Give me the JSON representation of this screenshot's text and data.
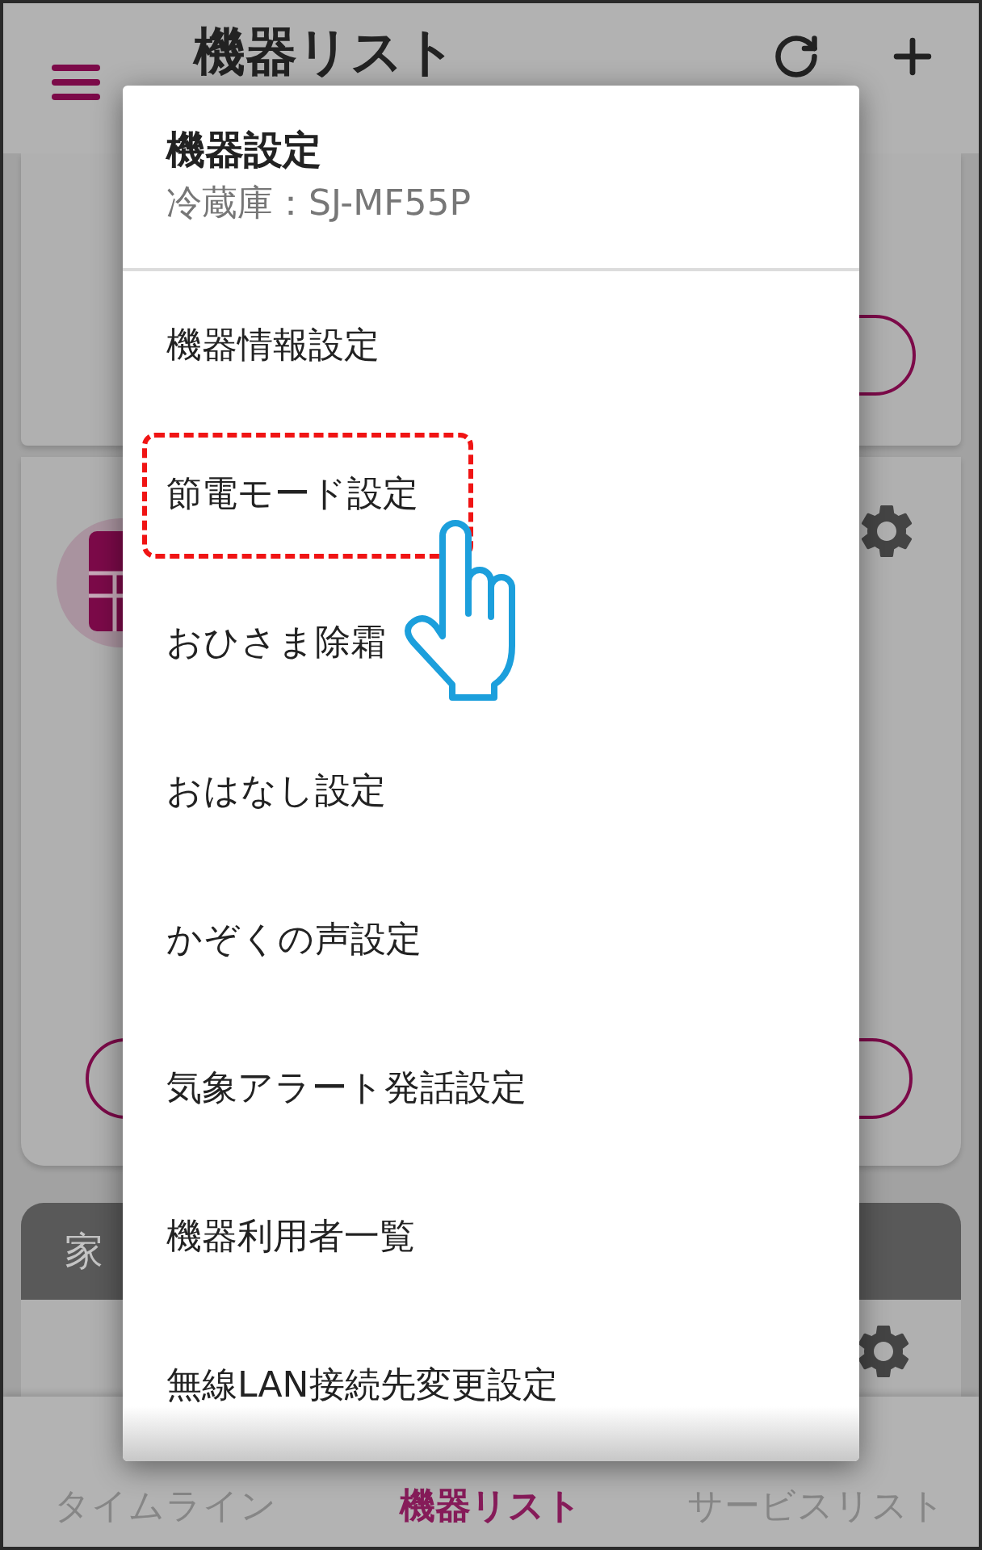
{
  "app_bar": {
    "title": "機器リスト"
  },
  "category_header": {
    "label": "家"
  },
  "dialog": {
    "title": "機器設定",
    "subtitle": "冷蔵庫：SJ-MF55P",
    "items": [
      {
        "label": "機器情報設定",
        "highlighted": false
      },
      {
        "label": "節電モード設定",
        "highlighted": true
      },
      {
        "label": "おひさま除霜",
        "highlighted": false
      },
      {
        "label": "おはなし設定",
        "highlighted": false
      },
      {
        "label": "かぞくの声設定",
        "highlighted": false
      },
      {
        "label": "気象アラート発話設定",
        "highlighted": false
      },
      {
        "label": "機器利用者一覧",
        "highlighted": false
      },
      {
        "label": "無線LAN接続先変更設定",
        "highlighted": false
      }
    ]
  },
  "bottom_nav": {
    "tabs": [
      {
        "label": "タイムライン",
        "selected": false
      },
      {
        "label": "機器リスト",
        "selected": true
      },
      {
        "label": "サービスリスト",
        "selected": false
      }
    ]
  }
}
